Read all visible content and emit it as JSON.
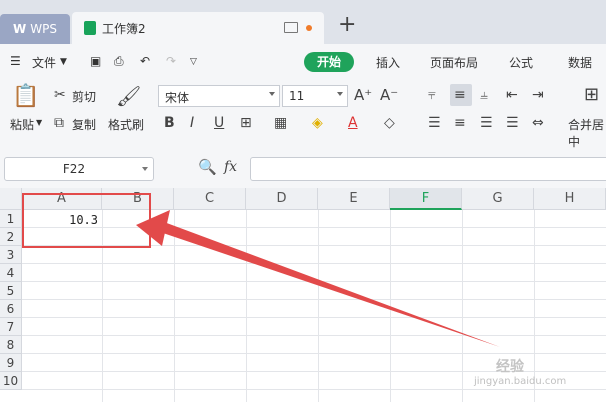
{
  "tabs": {
    "wps": "WPS",
    "doc": "工作簿2",
    "new_tab": "+"
  },
  "menu": {
    "file": "文件",
    "tabs": [
      "开始",
      "插入",
      "页面布局",
      "公式",
      "数据"
    ]
  },
  "ribbon": {
    "paste": "粘贴",
    "cut": "剪切",
    "copy": "复制",
    "format_painter": "格式刷",
    "font_name": "宋体",
    "font_size": "11",
    "merge": "合并居中"
  },
  "formula": {
    "name_box": "F22",
    "fx": "fx",
    "value": ""
  },
  "grid": {
    "columns": [
      "A",
      "B",
      "C",
      "D",
      "E",
      "F",
      "G",
      "H"
    ],
    "active_column": "F",
    "rows": [
      "1",
      "2",
      "3",
      "4",
      "5",
      "6",
      "7",
      "8",
      "9",
      "10"
    ],
    "cells": {
      "A1": "10.3"
    }
  },
  "watermark": {
    "brand": "经验",
    "url": "jingyan.baidu.com"
  },
  "colors": {
    "accent": "#1fa35b",
    "annotation": "#e24a4a",
    "wps_tab": "#9aa6c4"
  }
}
